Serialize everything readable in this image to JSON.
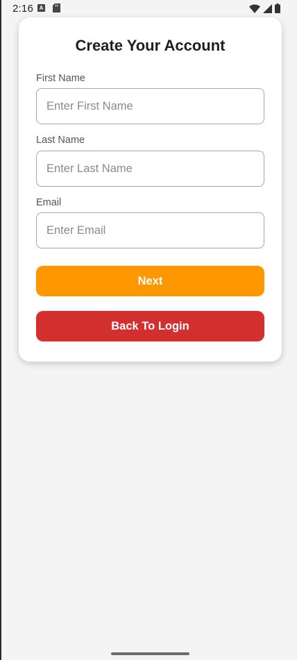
{
  "status_bar": {
    "time": "2:16",
    "a_icon_letter": "A"
  },
  "form": {
    "title": "Create Your Account",
    "first_name": {
      "label": "First Name",
      "placeholder": "Enter First Name",
      "value": ""
    },
    "last_name": {
      "label": "Last Name",
      "placeholder": "Enter Last Name",
      "value": ""
    },
    "email": {
      "label": "Email",
      "placeholder": "Enter Email",
      "value": ""
    },
    "next_label": "Next",
    "back_label": "Back To Login"
  },
  "colors": {
    "next_button": "#ff9800",
    "back_button": "#d32f2f",
    "background": "#f4f4f4"
  },
  "icons": [
    "wifi-icon",
    "cell-signal-icon",
    "battery-icon",
    "sd-card-icon",
    "accessibility-a-icon"
  ]
}
